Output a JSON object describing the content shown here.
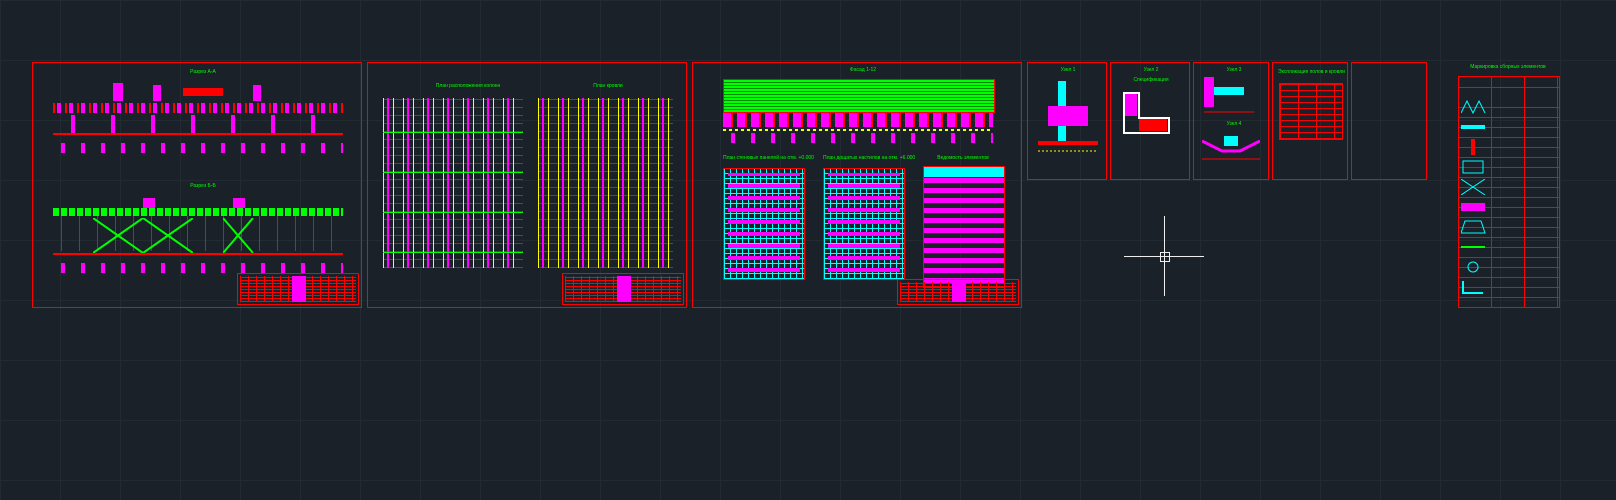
{
  "sheets": {
    "s1": {
      "title_top": "Разрез А-А",
      "title_bot": "Разрез Б-Б"
    },
    "s2": {
      "title_left": "План расположения колонн",
      "title_right": "План кровли"
    },
    "s3": {
      "title_top": "Фасад 1-12",
      "plan_left": "План стеновых панелей на отм. +0.000",
      "plan_right": "План дощатых настилов на отм. +6.000",
      "spec_title": "Ведомость элементов"
    },
    "s4a": {
      "title": "Узел 1"
    },
    "s4b": {
      "title": "Узел 2",
      "sub": "Спецификация"
    },
    "s4c": {
      "title": "Узел 3",
      "sub": "Узел 4"
    },
    "s4d": {
      "title": "Экспликация полов и кровли"
    },
    "side": {
      "title": "Маркировка сборных элементов"
    }
  },
  "colors": {
    "bg": "#1a2128",
    "frame": "#ff0000",
    "accent": "#ff00ff",
    "grid": "#ffff00",
    "struct": "#00ff00",
    "alt": "#00ffff"
  }
}
